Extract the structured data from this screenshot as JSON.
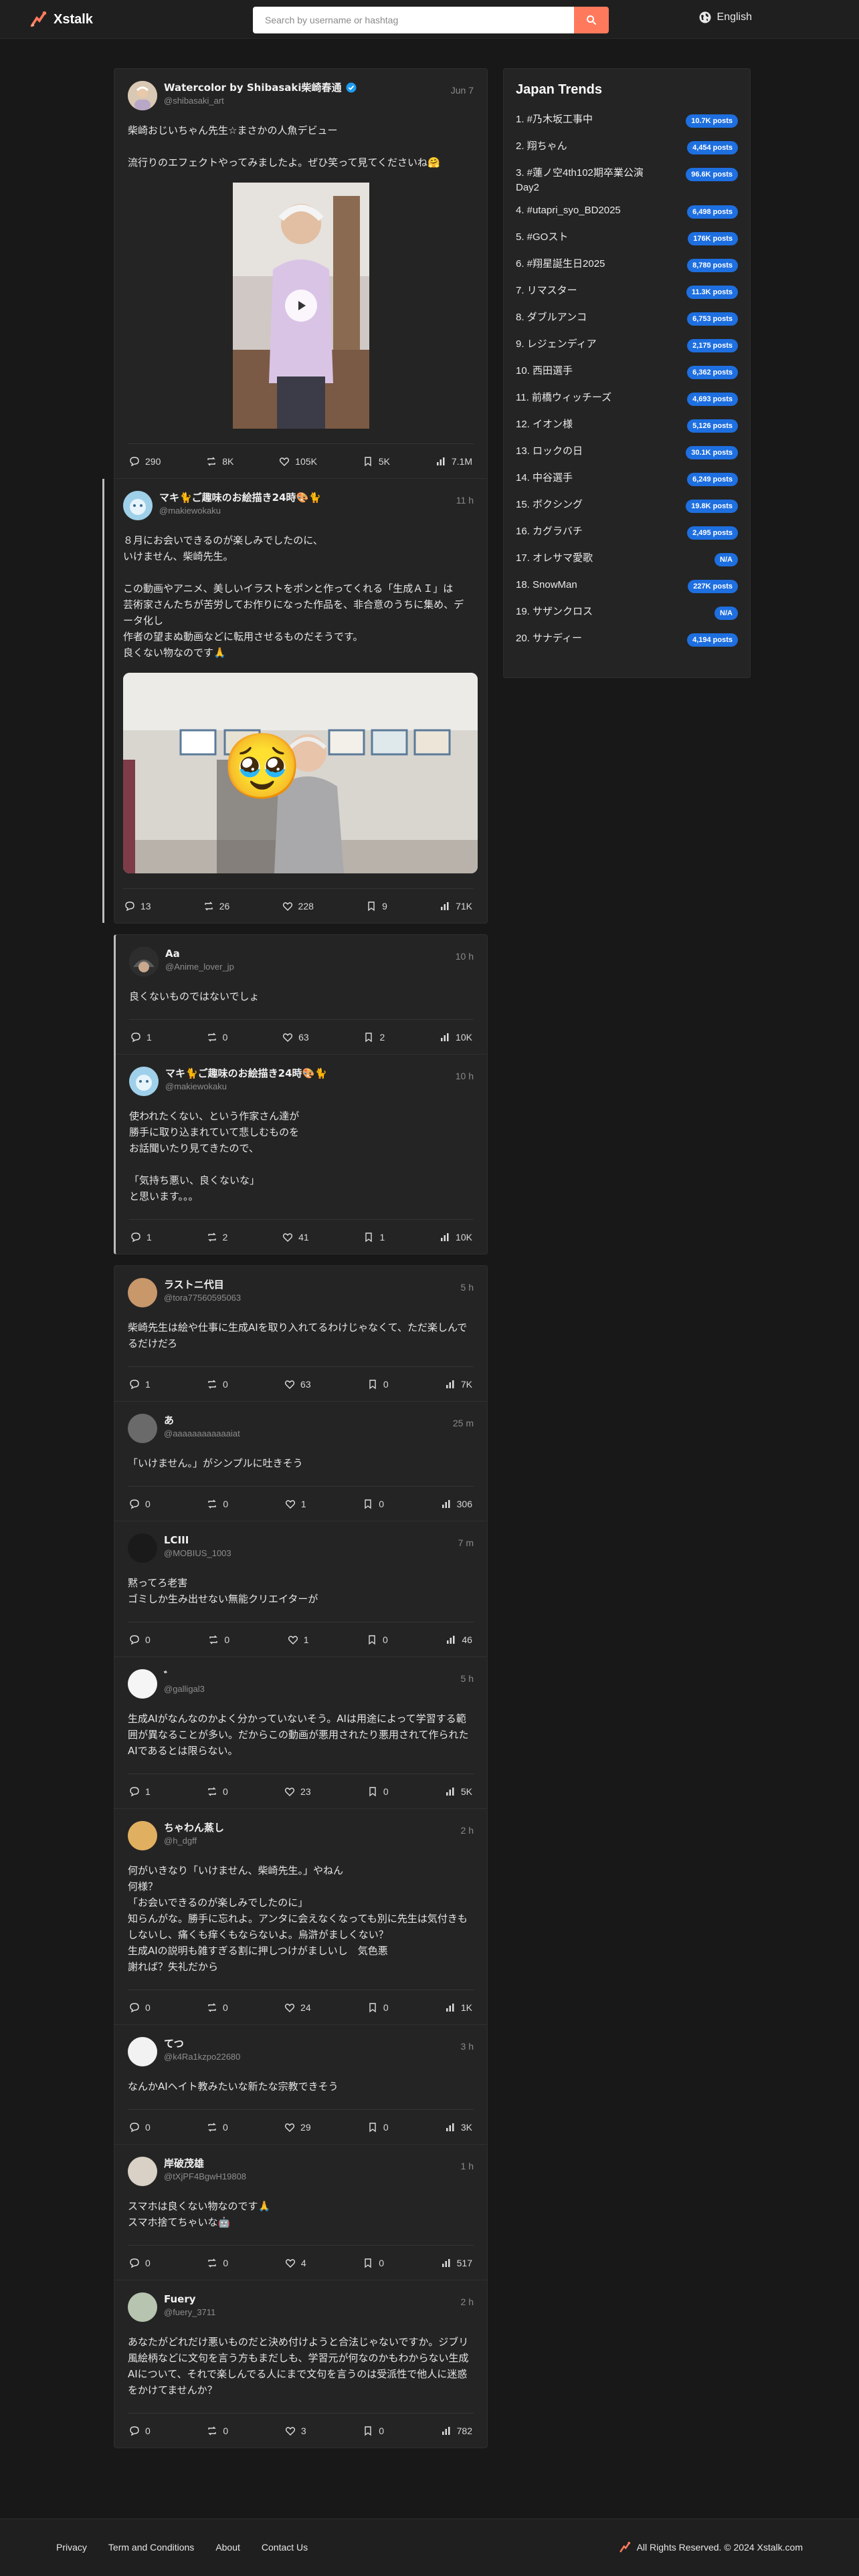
{
  "header": {
    "brand": "Xstalk",
    "search_placeholder": "Search by username or hashtag",
    "language": "English"
  },
  "threads": [
    {
      "posts": [
        {
          "name": "Watercolor by Shibasaki柴崎春通",
          "handle": "@shibasaki_art",
          "verified": true,
          "time": "Jun 7",
          "body": "柴崎おじいちゃん先生☆まさかの人魚デビュー\n\n流行りのエフェクトやってみましたよ。ぜひ笑って見てくださいね🤗",
          "actions": {
            "replies": "290",
            "reposts": "8K",
            "likes": "105K",
            "bookmarks": "5K",
            "views": "7.1M"
          }
        },
        {
          "name": "マキ🐈ご趣味のお絵描き24時🎨🐈",
          "handle": "@makiewokaku",
          "time": "11 h",
          "body": "８月にお会いできるのが楽しみでしたのに、\nいけません、柴崎先生。\n\nこの動画やアニメ、美しいイラストをポンと作ってくれる「生成ＡＩ」は\n芸術家さんたちが苦労してお作りになった作品を、非合意のうちに集め、データ化し\n作者の望まぬ動画などに転用させるものだそうです。\n良くない物なのです🙏",
          "emoji": "🥹",
          "actions": {
            "replies": "13",
            "reposts": "26",
            "likes": "228",
            "bookmarks": "9",
            "views": "71K"
          }
        }
      ]
    },
    {
      "posts": [
        {
          "name": "Aa",
          "handle": "@Anime_lover_jp",
          "time": "10 h",
          "body": "良くないものではないでしょ",
          "actions": {
            "replies": "1",
            "reposts": "0",
            "likes": "63",
            "bookmarks": "2",
            "views": "10K"
          }
        },
        {
          "name": "マキ🐈ご趣味のお絵描き24時🎨🐈",
          "handle": "@makiewokaku",
          "time": "10 h",
          "body": "使われたくない、という作家さん達が\n勝手に取り込まれていて悲しむものを\nお話聞いたり見てきたので、\n\n「気持ち悪い、良くないな」\nと思います。。。",
          "actions": {
            "replies": "1",
            "reposts": "2",
            "likes": "41",
            "bookmarks": "1",
            "views": "10K"
          }
        }
      ]
    },
    {
      "posts": [
        {
          "name": "ラストニ代目",
          "handle": "@tora77560595063",
          "time": "5 h",
          "body": "柴崎先生は絵や仕事に生成AIを取り入れてるわけじゃなくて、ただ楽しんでるだけだろ",
          "actions": {
            "replies": "1",
            "reposts": "0",
            "likes": "63",
            "bookmarks": "0",
            "views": "7K"
          }
        },
        {
          "name": "あ",
          "handle": "@aaaaaaaaaaaaiat",
          "time": "25 m",
          "body": "「いけません。」がシンプルに吐きそう",
          "actions": {
            "replies": "0",
            "reposts": "0",
            "likes": "1",
            "bookmarks": "0",
            "views": "306"
          }
        },
        {
          "name": "LCIII",
          "handle": "@MOBIUS_1003",
          "time": "7 m",
          "body": "黙ってろ老害\nゴミしか生み出せない無能クリエイターが",
          "actions": {
            "replies": "0",
            "reposts": "0",
            "likes": "1",
            "bookmarks": "0",
            "views": "46"
          }
        },
        {
          "name": "゛",
          "handle": "@galligal3",
          "time": "5 h",
          "body": "生成AIがなんなのかよく分かっていないそう。AIは用途によって学習する範囲が異なることが多い。だからこの動画が悪用されたり悪用されて作られたAIであるとは限らない。",
          "actions": {
            "replies": "1",
            "reposts": "0",
            "likes": "23",
            "bookmarks": "0",
            "views": "5K"
          }
        },
        {
          "name": "ちゃわん蒸し",
          "handle": "@h_dgff",
          "time": "2 h",
          "body": "何がいきなり「いけません、柴崎先生。」やねん\n何様？\n「お会いできるのが楽しみでしたのに」\n知らんがな。勝手に忘れよ。アンタに会えなくなっても別に先生は気付きもしないし、痛くも痒くもならないよ。烏滸がましくない？\n生成AIの説明も雑すぎる割に押しつけがましいし　気色悪\n謝れば？失礼だから",
          "actions": {
            "replies": "0",
            "reposts": "0",
            "likes": "24",
            "bookmarks": "0",
            "views": "1K"
          }
        },
        {
          "name": "てつ",
          "handle": "@k4Ra1kzpo22680",
          "time": "3 h",
          "body": "なんかAIヘイト教みたいな新たな宗教できそう",
          "actions": {
            "replies": "0",
            "reposts": "0",
            "likes": "29",
            "bookmarks": "0",
            "views": "3K"
          }
        },
        {
          "name": "岸破茂雄",
          "handle": "@tXjPF4BgwH19808",
          "time": "1 h",
          "body": "スマホは良くない物なのです🙏\nスマホ捨てちゃいな🤖",
          "actions": {
            "replies": "0",
            "reposts": "0",
            "likes": "4",
            "bookmarks": "0",
            "views": "517"
          }
        },
        {
          "name": "Fuery",
          "handle": "@fuery_3711",
          "time": "2 h",
          "body": "あなたがどれだけ悪いものだと決め付けようと合法じゃないですか。ジブリ風絵柄などに文句を言う方もまだしも、学習元が何なのかもわからない生成AIについて、それで楽しんでる人にまで文句を言うのは受派性で他人に迷惑をかけてませんか？",
          "actions": {
            "replies": "0",
            "reposts": "0",
            "likes": "3",
            "bookmarks": "0",
            "views": "782"
          }
        }
      ]
    }
  ],
  "trends": {
    "title": "Japan Trends",
    "items": [
      {
        "label": "1. #乃木坂工事中",
        "count": "10.7K posts"
      },
      {
        "label": "2. 翔ちゃん",
        "count": "4,454 posts"
      },
      {
        "label": "3. #蓮ノ空4th102期卒業公演Day2",
        "count": "96.6K posts"
      },
      {
        "label": "4. #utapri_syo_BD2025",
        "count": "6,498 posts"
      },
      {
        "label": "5. #GOスト",
        "count": "176K posts"
      },
      {
        "label": "6. #翔星誕生日2025",
        "count": "8,780 posts"
      },
      {
        "label": "7. リマスター",
        "count": "11.3K posts"
      },
      {
        "label": "8. ダブルアンコ",
        "count": "6,753 posts"
      },
      {
        "label": "9. レジェンディア",
        "count": "2,175 posts"
      },
      {
        "label": "10. 西田選手",
        "count": "6,362 posts"
      },
      {
        "label": "11. 前橋ウィッチーズ",
        "count": "4,693 posts"
      },
      {
        "label": "12. イオン様",
        "count": "5,126 posts"
      },
      {
        "label": "13. ロックの日",
        "count": "30.1K posts"
      },
      {
        "label": "14. 中谷選手",
        "count": "6,249 posts"
      },
      {
        "label": "15. ボクシング",
        "count": "19.8K posts"
      },
      {
        "label": "16. カグラバチ",
        "count": "2,495 posts"
      },
      {
        "label": "17. オレサマ愛歌",
        "count": "N/A"
      },
      {
        "label": "18. SnowMan",
        "count": "227K posts"
      },
      {
        "label": "19. サザンクロス",
        "count": "N/A"
      },
      {
        "label": "20. サナディー",
        "count": "4,194 posts"
      }
    ]
  },
  "footer": {
    "links": [
      "Privacy",
      "Term and Conditions",
      "About",
      "Contact Us"
    ],
    "copyright": "All Rights Reserved. © 2024 Xstalk.com"
  },
  "colors": {
    "accent": "#ff7a5c",
    "badge": "#1e6fe0",
    "verified": "#1d9bf0"
  }
}
